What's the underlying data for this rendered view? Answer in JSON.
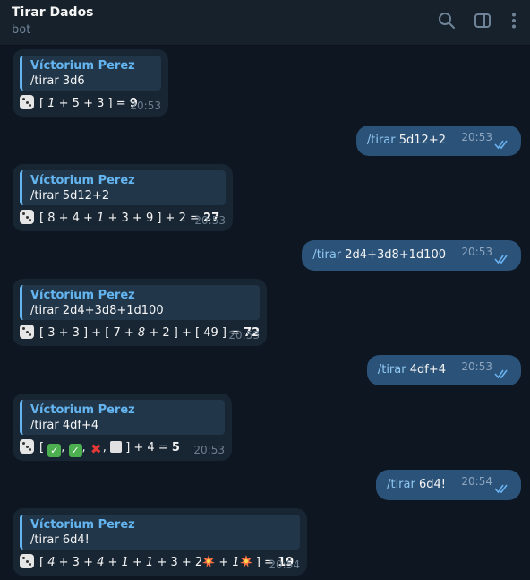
{
  "header": {
    "title": "Tirar Dados",
    "subtitle": "bot"
  },
  "sender": "Víctorium Perez",
  "messages": [
    {
      "quote": "/tirar 3d6",
      "time": "20:53"
    },
    {
      "cmd": "/tirar",
      "args": "5d12+2",
      "time": "20:53"
    },
    {
      "quote": "/tirar 5d12+2",
      "time": "20:53"
    },
    {
      "cmd": "/tirar",
      "args": "2d4+3d8+1d100",
      "time": "20:53"
    },
    {
      "quote": "/tirar 2d4+3d8+1d100",
      "time": "20:53"
    },
    {
      "cmd": "/tirar",
      "args": "4df+4",
      "time": "20:53"
    },
    {
      "quote": "/tirar 4df+4",
      "time": "20:53"
    },
    {
      "cmd": "/tirar",
      "args": "6d4!",
      "time": "20:54"
    },
    {
      "quote": "/tirar 6d4!",
      "time": "20:54"
    }
  ],
  "results": {
    "r1": {
      "open": "[",
      "a": "1",
      "b": "+ 5 + 3 ]",
      "eq": "=",
      "total": "9"
    },
    "r2": {
      "pre": "[ 8 + 4 +",
      "a": "1",
      "post": "+ 3 + 9 ] + 2 =",
      "total": "27"
    },
    "r3": {
      "pre": "[ 3 + 3 ] + [ 7 +",
      "a": "8",
      "post": "+ 2 ] + [ 49 ] =",
      "total": "72"
    },
    "r4": {
      "open": "[",
      "sep1": ",",
      "sep2": ",",
      "sep3": ",",
      "post": "] + 4 =",
      "total": "5"
    },
    "r5": {
      "open": "[",
      "a": "4",
      "b": "+ 3 +",
      "c": "4",
      "d": "+",
      "e": "1",
      "f": "+",
      "g": "1",
      "h": "+ 3 + 2",
      "i": "+",
      "j": "1",
      "k": "] =",
      "total": "19"
    }
  }
}
